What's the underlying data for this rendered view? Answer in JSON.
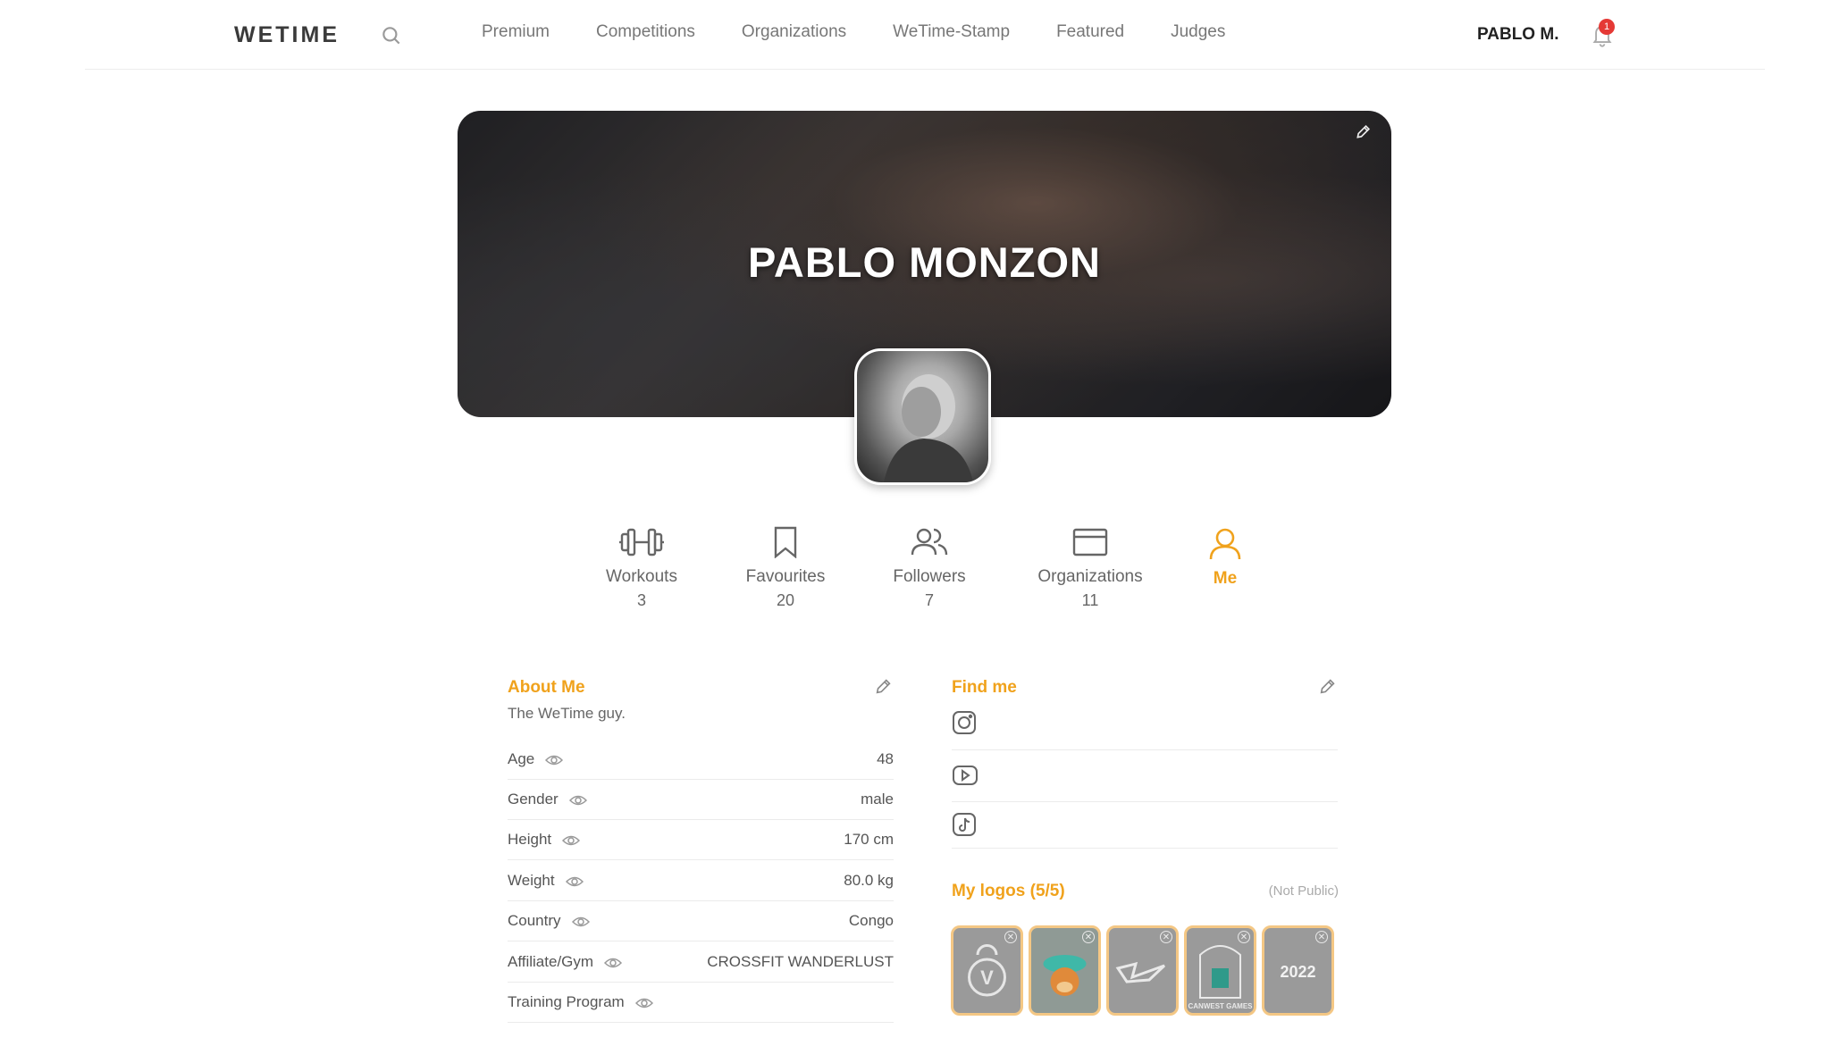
{
  "header": {
    "logo": "WETIME",
    "nav": [
      "Premium",
      "Competitions",
      "Organizations",
      "WeTime-Stamp",
      "Featured",
      "Judges"
    ],
    "user_name": "PABLO M.",
    "notification_count": "1"
  },
  "profile": {
    "full_name": "PABLO MONZON"
  },
  "stats": [
    {
      "label": "Workouts",
      "count": "3",
      "icon": "dumbbell-icon"
    },
    {
      "label": "Favourites",
      "count": "20",
      "icon": "bookmark-icon"
    },
    {
      "label": "Followers",
      "count": "7",
      "icon": "users-icon"
    },
    {
      "label": "Organizations",
      "count": "11",
      "icon": "card-icon"
    },
    {
      "label": "Me",
      "count": "",
      "icon": "user-icon",
      "active": true
    }
  ],
  "about": {
    "title": "About Me",
    "text": "The WeTime guy.",
    "fields": [
      {
        "label": "Age",
        "value": "48"
      },
      {
        "label": "Gender",
        "value": "male"
      },
      {
        "label": "Height",
        "value": "170 cm"
      },
      {
        "label": "Weight",
        "value": "80.0 kg"
      },
      {
        "label": "Country",
        "value": "Congo"
      },
      {
        "label": "Affiliate/Gym",
        "value": "CROSSFIT WANDERLUST"
      },
      {
        "label": "Training Program",
        "value": ""
      }
    ]
  },
  "find_me": {
    "title": "Find me",
    "socials": [
      "instagram-icon",
      "youtube-icon",
      "tiktok-icon"
    ]
  },
  "logos": {
    "title": "My logos (5/5)",
    "note": "(Not Public)",
    "tiles": [
      {
        "name": "kettlebell-v-logo",
        "text": "V"
      },
      {
        "name": "monkey-mascot-logo",
        "text": ""
      },
      {
        "name": "swoosh-logo",
        "text": ""
      },
      {
        "name": "canwest-games-logo",
        "text": "CANWEST GAMES"
      },
      {
        "name": "2022-logo",
        "text": "2022"
      }
    ]
  },
  "colors": {
    "accent": "#f0a21c",
    "badge": "#e53935",
    "tile_border": "#f4c784"
  }
}
